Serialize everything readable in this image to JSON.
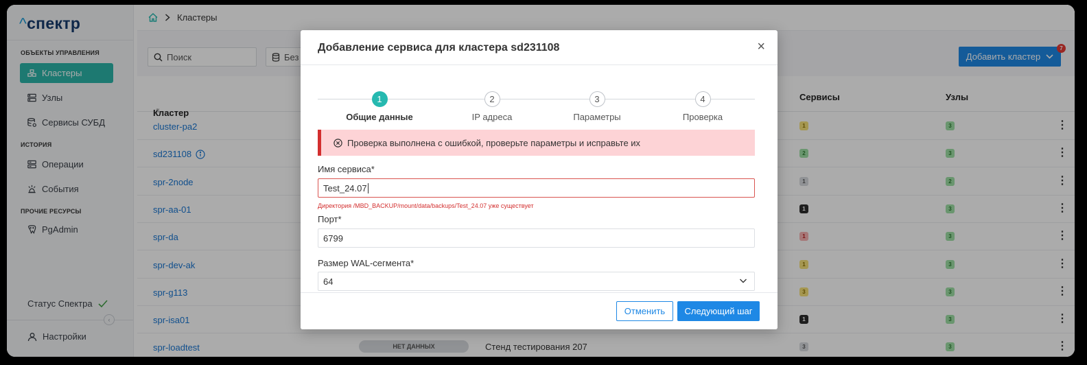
{
  "app": {
    "logo": "спектр",
    "logo_caret": "^"
  },
  "sidebar": {
    "sections": [
      {
        "title": "ОБЪЕКТЫ УПРАВЛЕНИЯ"
      },
      {
        "title": "ИСТОРИЯ"
      },
      {
        "title": "ПРОЧИЕ РЕСУРСЫ"
      }
    ],
    "items": [
      {
        "label": "Кластеры",
        "icon": "clusters-icon",
        "active": true
      },
      {
        "label": "Узлы",
        "icon": "nodes-icon"
      },
      {
        "label": "Сервисы СУБД",
        "icon": "db-services-icon"
      },
      {
        "label": "Операции",
        "icon": "operations-icon"
      },
      {
        "label": "События",
        "icon": "events-icon"
      },
      {
        "label": "PgAdmin",
        "icon": "pgadmin-icon"
      }
    ],
    "status_label": "Статус Спектра",
    "settings_label": "Настройки"
  },
  "breadcrumb": {
    "current": "Кластеры"
  },
  "toolbar": {
    "search_placeholder": "Поиск",
    "filter_label": "Без г",
    "add_cluster_label": "Добавить кластер",
    "notification_count": "7"
  },
  "table": {
    "columns": {
      "cluster": "Кластер",
      "sort": "⇅",
      "services": "Сервисы",
      "nodes": "Узлы"
    },
    "rows": [
      {
        "name": "cluster-pa2",
        "services": "1",
        "svc_bg": "#f7e27a",
        "svc_fg": "#8a6d00",
        "nodes": "3"
      },
      {
        "name": "sd231108",
        "info": "i",
        "services": "2",
        "svc_bg": "#9fe0a6",
        "svc_fg": "#2e7d32",
        "nodes": "3"
      },
      {
        "name": "spr-2node",
        "services": "1",
        "svc_bg": "#d7dade",
        "svc_fg": "#555555",
        "nodes": "2"
      },
      {
        "name": "spr-aa-01",
        "services": "1",
        "svc_bg": "#2e2e2e",
        "svc_fg": "#ffffff",
        "nodes": "3"
      },
      {
        "name": "spr-da",
        "services": "1",
        "svc_bg": "#f8b3b3",
        "svc_fg": "#b71c1c",
        "nodes": "3"
      },
      {
        "name": "spr-dev-ak",
        "services": "1",
        "svc_bg": "#f7e27a",
        "svc_fg": "#8a6d00",
        "nodes": "3"
      },
      {
        "name": "spr-g113",
        "services": "3",
        "svc_bg": "#f7e27a",
        "svc_fg": "#8a6d00",
        "nodes": "3"
      },
      {
        "name": "spr-isa01",
        "services": "1",
        "svc_bg": "#2e2e2e",
        "svc_fg": "#ffffff",
        "nodes": "3"
      },
      {
        "name": "spr-loadtest",
        "status": "НЕТ ДАННЫХ",
        "description": "Стенд тестирования 207",
        "services": "3",
        "svc_bg": "#d7dade",
        "svc_fg": "#555555",
        "nodes": "3"
      }
    ],
    "row_menu": "⋮"
  },
  "modal": {
    "title": "Добавление сервиса для кластера sd231108",
    "close": "×",
    "steps": [
      {
        "num": "1",
        "label": "Общие данные",
        "active": true
      },
      {
        "num": "2",
        "label": "IP адреса"
      },
      {
        "num": "3",
        "label": "Параметры"
      },
      {
        "num": "4",
        "label": "Проверка"
      }
    ],
    "alert": "Проверка выполнена с ошибкой, проверьте параметры и исправьте их",
    "fields": {
      "service_name": {
        "label": "Имя сервиса*",
        "value": "Test_24.07",
        "error": "Директория /MBD_BACKUP/mount/data/backups/Test_24.07 уже существует"
      },
      "port": {
        "label": "Порт*",
        "value": "6799"
      },
      "wal": {
        "label": "Размер WAL-сегмента*",
        "value": "64"
      }
    },
    "cancel_label": "Отменить",
    "next_label": "Следующий шаг"
  },
  "colors": {
    "accent": "#1e88e5",
    "active_nav": "#2cb5a9",
    "step_active": "#26b9b0",
    "error": "#d32f2f"
  }
}
